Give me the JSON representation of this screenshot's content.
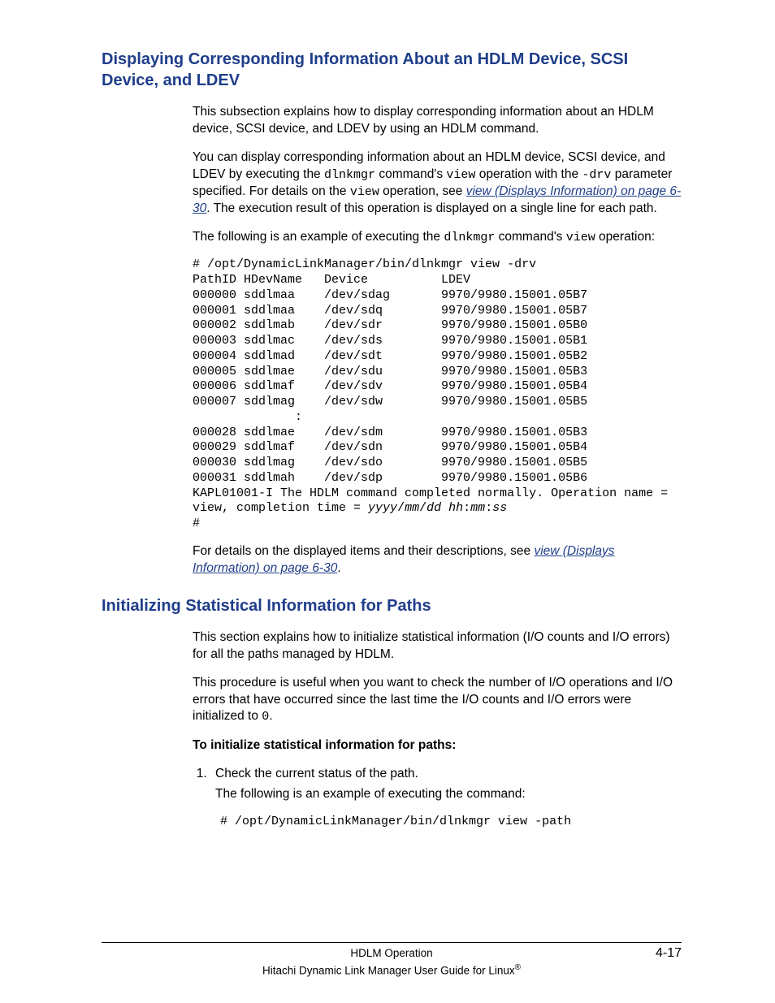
{
  "s1": {
    "heading": "Displaying Corresponding Information About an HDLM Device, SCSI Device, and LDEV",
    "p1": "This subsection explains how to display corresponding information about an HDLM device, SCSI device, and LDEV by using an HDLM command.",
    "p2a": "You can display corresponding information about an HDLM device, SCSI device, and LDEV by executing the ",
    "p2_cmd": "dlnkmgr",
    "p2b": " command's ",
    "p2_op": "view",
    "p2c": " operation with the ",
    "p2_drv": "-drv",
    "p2d": " parameter specified. For details on the ",
    "p2_op2": "view",
    "p2e": " operation, see ",
    "p2_link": "view (Displays Information) on page 6-30",
    "p2f": ". The execution result of this operation is displayed on a single line for each path.",
    "p3a": "The following is an example of executing the ",
    "p3_cmd": "dlnkmgr",
    "p3b": " command's ",
    "p3_op": "view",
    "p3c": " operation:",
    "code1": "# /opt/DynamicLinkManager/bin/dlnkmgr view -drv\nPathID HDevName   Device          LDEV\n000000 sddlmaa    /dev/sdag       9970/9980.15001.05B7\n000001 sddlmaa    /dev/sdq        9970/9980.15001.05B7\n000002 sddlmab    /dev/sdr        9970/9980.15001.05B0\n000003 sddlmac    /dev/sds        9970/9980.15001.05B1\n000004 sddlmad    /dev/sdt        9970/9980.15001.05B2\n000005 sddlmae    /dev/sdu        9970/9980.15001.05B3\n000006 sddlmaf    /dev/sdv        9970/9980.15001.05B4\n000007 sddlmag    /dev/sdw        9970/9980.15001.05B5\n              :\n000028 sddlmae    /dev/sdm        9970/9980.15001.05B3\n000029 sddlmaf    /dev/sdn        9970/9980.15001.05B4\n000030 sddlmag    /dev/sdo        9970/9980.15001.05B5\n000031 sddlmah    /dev/sdp        9970/9980.15001.05B6\nKAPL01001-I The HDLM command completed normally. Operation name = \nview, completion time = ",
    "code1_it": "yyyy",
    "code1_s1": "/",
    "code1_it2": "mm",
    "code1_s2": "/",
    "code1_it3": "dd",
    "code1_sp": " ",
    "code1_it4": "hh",
    "code1_s3": ":",
    "code1_it5": "mm",
    "code1_s4": ":",
    "code1_it6": "ss",
    "code1_end": "\n#",
    "p4a": "For details on the displayed items and their descriptions, see ",
    "p4_link": "view (Displays Information) on page 6-30",
    "p4b": "."
  },
  "s2": {
    "heading": "Initializing Statistical Information for Paths",
    "p1": "This section explains how to initialize statistical information (I/O counts and I/O errors) for all the paths managed by HDLM.",
    "p2a": "This procedure is useful when you want to check the number of I/O operations and I/O errors that have occurred since the last time the I/O counts and I/O errors were initialized to ",
    "p2_zero": "0",
    "p2b": ".",
    "sub": "To initialize statistical information for paths:",
    "li1a": "Check the current status of the path.",
    "li1b": "The following is an example of executing the command:",
    "li1code": "# /opt/DynamicLinkManager/bin/dlnkmgr view -path"
  },
  "footer": {
    "l1": "HDLM Operation",
    "page": "4-17",
    "l2a": "Hitachi Dynamic Link Manager User Guide for Linux",
    "reg": "®"
  }
}
